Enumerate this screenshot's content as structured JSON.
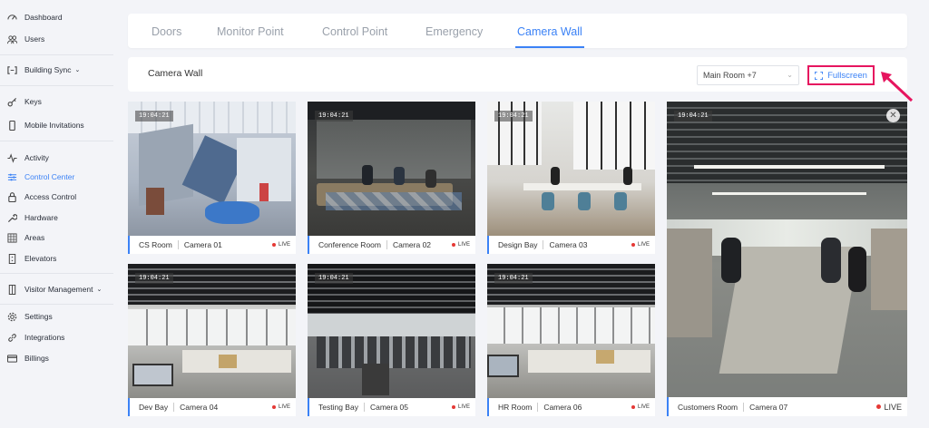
{
  "sidebar": {
    "items": [
      {
        "label": "Dashboard",
        "icon": "dashboard-icon"
      },
      {
        "label": "Users",
        "icon": "users-icon"
      },
      {
        "label": "Building Sync",
        "icon": "sync-icon"
      },
      {
        "label": "Keys",
        "icon": "key-icon"
      },
      {
        "label": "Mobile Invitations",
        "icon": "mobile-icon"
      },
      {
        "label": "Activity",
        "icon": "activity-icon"
      },
      {
        "label": "Control Center",
        "icon": "control-center-icon"
      },
      {
        "label": "Access Control",
        "icon": "lock-icon"
      },
      {
        "label": "Hardware",
        "icon": "wrench-icon"
      },
      {
        "label": "Areas",
        "icon": "grid-icon"
      },
      {
        "label": "Elevators",
        "icon": "elevator-icon"
      },
      {
        "label": "Visitor Management",
        "icon": "door-icon"
      },
      {
        "label": "Settings",
        "icon": "gear-icon"
      },
      {
        "label": "Integrations",
        "icon": "link-icon"
      },
      {
        "label": "Billings",
        "icon": "card-icon"
      }
    ],
    "active": "Control Center"
  },
  "tabs": [
    "Doors",
    "Monitor Point",
    "Control Point",
    "Emergency",
    "Camera Wall"
  ],
  "active_tab": "Camera Wall",
  "toolbar": {
    "title": "Camera Wall",
    "room_select": "Main Room +7",
    "fullscreen_label": "Fullscreen"
  },
  "cameras": [
    {
      "room": "CS Room",
      "camera": "Camera 01",
      "time": "19:04:21",
      "live": "LIVE"
    },
    {
      "room": "Conference Room",
      "camera": "Camera 02",
      "time": "19:04:21",
      "live": "LIVE"
    },
    {
      "room": "Design Bay",
      "camera": "Camera 03",
      "time": "19:04:21",
      "live": "LIVE"
    },
    {
      "room": "Customers Room",
      "camera": "Camera 07",
      "time": "19:04:21",
      "live": "LIVE"
    },
    {
      "room": "Dev Bay",
      "camera": "Camera 04",
      "time": "19:04:21",
      "live": "LIVE"
    },
    {
      "room": "Testing Bay",
      "camera": "Camera 05",
      "time": "19:04:21",
      "live": "LIVE"
    },
    {
      "room": "HR Room",
      "camera": "Camera 06",
      "time": "19:04:21",
      "live": "LIVE"
    }
  ],
  "colors": {
    "accent": "#3b82f6",
    "highlight": "#e6155f",
    "live_dot": "#e53935"
  }
}
